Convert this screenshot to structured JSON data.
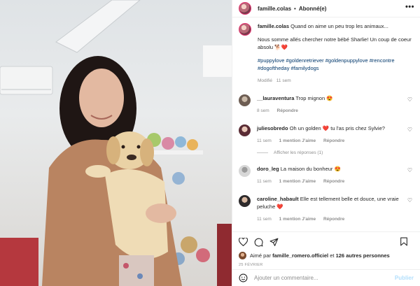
{
  "header": {
    "username": "famille.colas",
    "separator": "•",
    "follow_status": "Abonné(e)",
    "more": "•••"
  },
  "caption": {
    "username": "famille.colas",
    "text": "Quand on aime un peu trop les animaux...",
    "paragraph": "Nous somme allés chercher notre bébé Sharlie! Un coup de coeur absolu 🐕❤️",
    "hashtags": "#puppylove #goldenretriever #goldenpuppylove #rencontre #dogoftheday #familydogs",
    "edited": "Modifié",
    "time": "11 sem"
  },
  "comments": [
    {
      "username": "__lauraventura",
      "text": "Trop mignon 😍",
      "time": "8 sem",
      "likes": "",
      "reply": "Répondre"
    },
    {
      "username": "juliesobredo",
      "text": "Oh un golden ❤️ tu l'as pris chez Sylvie?",
      "time": "11 sem",
      "likes": "1 mention J'aime",
      "reply": "Répondre",
      "view_replies": "Afficher les réponses (1)"
    },
    {
      "username": "doro_leg",
      "text": "La maison du bonheur 😍",
      "time": "11 sem",
      "likes": "1 mention J'aime",
      "reply": "Répondre"
    },
    {
      "username": "caroline_habault",
      "text": "Elle est tellement belle et douce, une vraie peluche ❤️",
      "time": "11 sem",
      "likes": "1 mention J'aime",
      "reply": "Répondre"
    }
  ],
  "likes": {
    "prefix": "Aimé par",
    "user": "famille_romero.officiel",
    "conj": "et",
    "others": "126 autres personnes"
  },
  "date": "25 FÉVRIER",
  "add_comment": {
    "placeholder": "Ajouter un commentaire...",
    "post_label": "Publier"
  },
  "icons": {
    "like": "heart-icon",
    "comment": "comment-icon",
    "share": "share-icon",
    "save": "bookmark-icon",
    "emoji": "emoji-icon"
  }
}
